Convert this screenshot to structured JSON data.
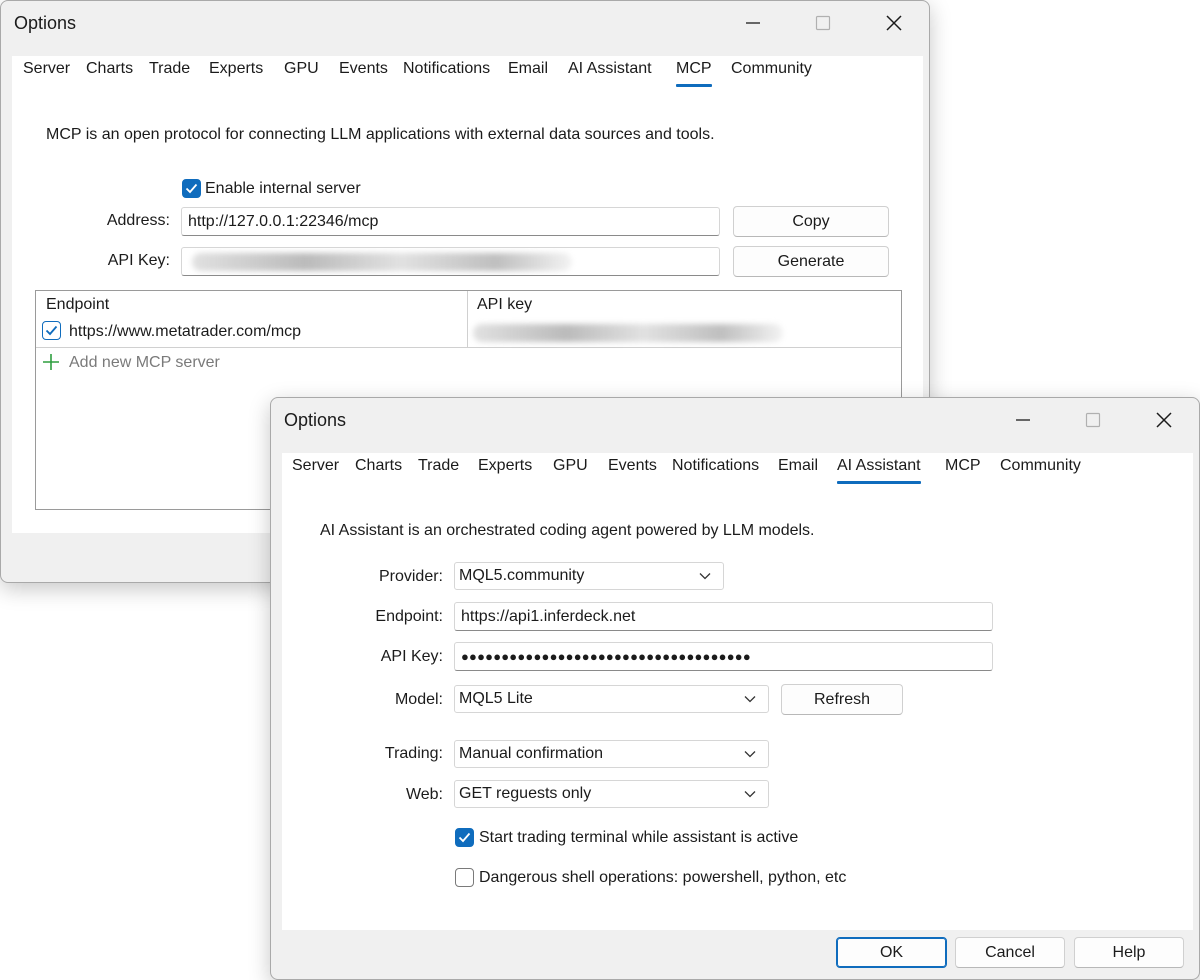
{
  "back_window": {
    "title": "Options",
    "tabs": [
      {
        "label": "Server",
        "active": false
      },
      {
        "label": "Charts",
        "active": false
      },
      {
        "label": "Trade",
        "active": false
      },
      {
        "label": "Experts",
        "active": false
      },
      {
        "label": "GPU",
        "active": false
      },
      {
        "label": "Events",
        "active": false
      },
      {
        "label": "Notifications",
        "active": false
      },
      {
        "label": "Email",
        "active": false
      },
      {
        "label": "AI Assistant",
        "active": false
      },
      {
        "label": "MCP",
        "active": true
      },
      {
        "label": "Community",
        "active": false
      }
    ],
    "description": "MCP is an open protocol for connecting LLM applications with external data sources and tools.",
    "enable_server_label": "Enable internal server",
    "enable_server_checked": true,
    "address_label": "Address:",
    "address_value": "http://127.0.0.1:22346/mcp",
    "copy_label": "Copy",
    "api_key_label": "API Key:",
    "generate_label": "Generate",
    "table": {
      "columns": [
        "Endpoint",
        "API key"
      ],
      "rows": [
        {
          "checked": true,
          "endpoint": "https://www.metatrader.com/mcp"
        }
      ],
      "add_label": "Add new MCP server"
    }
  },
  "front_window": {
    "title": "Options",
    "tabs": [
      {
        "label": "Server",
        "active": false
      },
      {
        "label": "Charts",
        "active": false
      },
      {
        "label": "Trade",
        "active": false
      },
      {
        "label": "Experts",
        "active": false
      },
      {
        "label": "GPU",
        "active": false
      },
      {
        "label": "Events",
        "active": false
      },
      {
        "label": "Notifications",
        "active": false
      },
      {
        "label": "Email",
        "active": false
      },
      {
        "label": "AI Assistant",
        "active": true
      },
      {
        "label": "MCP",
        "active": false
      },
      {
        "label": "Community",
        "active": false
      }
    ],
    "description": "AI Assistant is an orchestrated coding agent powered by LLM models.",
    "provider_label": "Provider:",
    "provider_value": "MQL5.community",
    "endpoint_label": "Endpoint:",
    "endpoint_value": "https://api1.inferdeck.net",
    "api_key_label": "API Key:",
    "api_key_masked": "●●●●●●●●●●●●●●●●●●●●●●●●●●●●●●●●●●●●",
    "model_label": "Model:",
    "model_value": "MQL5 Lite",
    "refresh_label": "Refresh",
    "trading_label": "Trading:",
    "trading_value": "Manual confirmation",
    "web_label": "Web:",
    "web_value": "GET reguests only",
    "start_terminal_label": "Start trading terminal while assistant is active",
    "start_terminal_checked": true,
    "dangerous_shell_label": "Dangerous shell operations: powershell, python, etc",
    "dangerous_shell_checked": false,
    "ok_label": "OK",
    "cancel_label": "Cancel",
    "help_label": "Help"
  },
  "colors": {
    "accent": "#0f6cbd",
    "add_icon": "#2e9e3f",
    "window_bg": "#f0f0f0",
    "panel_bg": "#ffffff"
  },
  "icons": [
    "minimize-icon",
    "maximize-icon",
    "close-icon",
    "checkmark-icon",
    "chevron-down-icon",
    "plus-icon"
  ]
}
